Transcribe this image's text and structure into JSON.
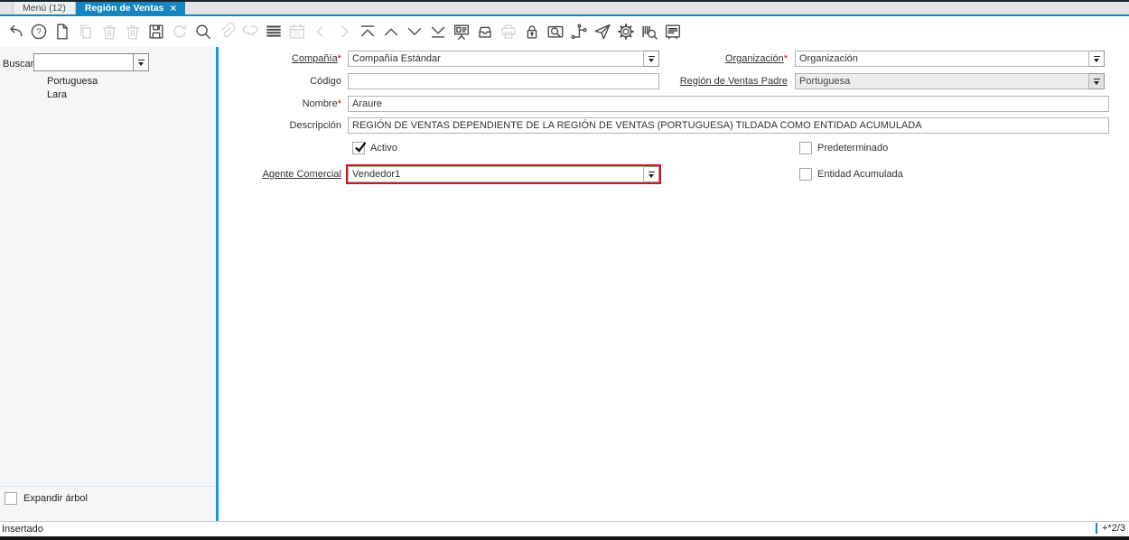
{
  "window": {
    "tabs": [
      {
        "label": "Menú (12)",
        "active": false
      },
      {
        "label": "Región de Ventas",
        "active": true,
        "close": "×"
      }
    ]
  },
  "toolbar": {
    "icons": [
      {
        "name": "undo",
        "enabled": true
      },
      {
        "name": "help",
        "enabled": true
      },
      {
        "name": "new-record",
        "enabled": true
      },
      {
        "name": "copy-record",
        "enabled": false
      },
      {
        "name": "delete-record",
        "enabled": false
      },
      {
        "name": "delete-selection",
        "enabled": false
      },
      {
        "name": "save",
        "enabled": true
      },
      {
        "name": "refresh",
        "enabled": false
      },
      {
        "name": "find",
        "enabled": true
      },
      {
        "name": "attachment",
        "enabled": false
      },
      {
        "name": "chat",
        "enabled": false
      },
      {
        "name": "grid-toggle",
        "enabled": true
      },
      {
        "name": "calendar",
        "enabled": false
      },
      {
        "name": "nav-left",
        "enabled": false
      },
      {
        "name": "nav-right",
        "enabled": false
      },
      {
        "name": "first-record",
        "enabled": true
      },
      {
        "name": "previous-record",
        "enabled": true
      },
      {
        "name": "next-record",
        "enabled": true
      },
      {
        "name": "last-record",
        "enabled": true
      },
      {
        "name": "report",
        "enabled": true
      },
      {
        "name": "archive",
        "enabled": true
      },
      {
        "name": "print",
        "enabled": false
      },
      {
        "name": "lock",
        "enabled": true
      },
      {
        "name": "zoom-across",
        "enabled": true
      },
      {
        "name": "workflow",
        "enabled": true
      },
      {
        "name": "send",
        "enabled": true
      },
      {
        "name": "settings",
        "enabled": true
      },
      {
        "name": "product-info",
        "enabled": true
      },
      {
        "name": "quick-form",
        "enabled": true
      }
    ]
  },
  "sidebar": {
    "search_label": "Buscar:",
    "search_value": "",
    "tree_items": [
      "Portuguesa",
      "Lara"
    ],
    "expand_tree": {
      "label": "Expandir árbol",
      "checked": false
    }
  },
  "form": {
    "required_marker": "*",
    "compania": {
      "label": "Compañía",
      "value": "Compañía Estándar"
    },
    "organizacion": {
      "label": "Organización",
      "value": "Organización"
    },
    "codigo": {
      "label": "Código",
      "value": ""
    },
    "region_padre": {
      "label": "Región de Ventas Padre",
      "value": "Portuguesa"
    },
    "nombre": {
      "label": "Nombre",
      "value": "Araure"
    },
    "descripcion": {
      "label": "Descripción",
      "value": "REGIÓN DE VENTAS DEPENDIENTE DE LA REGIÓN DE VENTAS (PORTUGUESA) TILDADA COMO ENTIDAD ACUMULADA"
    },
    "activo": {
      "label": "Activo",
      "checked": true
    },
    "predeterminado": {
      "label": "Predeterminado",
      "checked": false
    },
    "agente": {
      "label": "Agente Comercial",
      "value": "Vendedor1"
    },
    "entidad": {
      "label": "Entidad Acumulada",
      "checked": false
    }
  },
  "statusbar": {
    "state": "Insertado",
    "record_indicator": "+*2/3"
  },
  "colors": {
    "accent": "#1786c0",
    "splitter": "#0d9ddc",
    "highlight_border": "#d01716",
    "required": "#e00000",
    "top_strip": "#16242e"
  }
}
